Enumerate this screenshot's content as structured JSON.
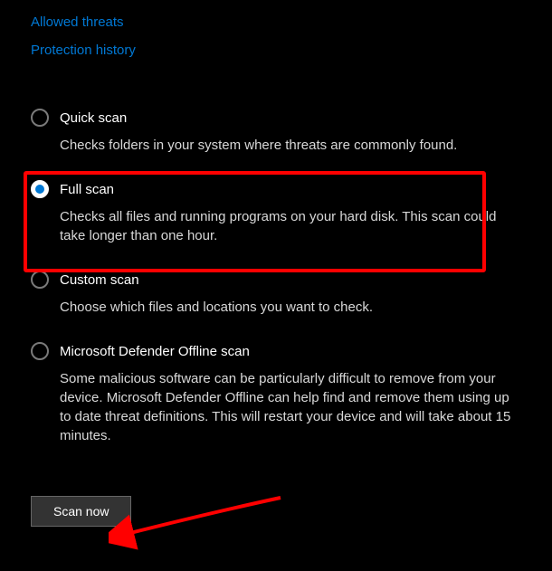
{
  "links": {
    "allowed_threats": "Allowed threats",
    "protection_history": "Protection history"
  },
  "scan_options": {
    "quick": {
      "title": "Quick scan",
      "desc": "Checks folders in your system where threats are commonly found."
    },
    "full": {
      "title": "Full scan",
      "desc": "Checks all files and running programs on your hard disk. This scan could take longer than one hour."
    },
    "custom": {
      "title": "Custom scan",
      "desc": "Choose which files and locations you want to check."
    },
    "offline": {
      "title": "Microsoft Defender Offline scan",
      "desc": "Some malicious software can be particularly difficult to remove from your device. Microsoft Defender Offline can help find and remove them using up to date threat definitions. This will restart your device and will take about 15 minutes."
    }
  },
  "selected_option": "full",
  "button": {
    "scan_now": "Scan now"
  },
  "annotations": {
    "highlight_color": "#ff0000",
    "arrow_color": "#ff0000"
  }
}
